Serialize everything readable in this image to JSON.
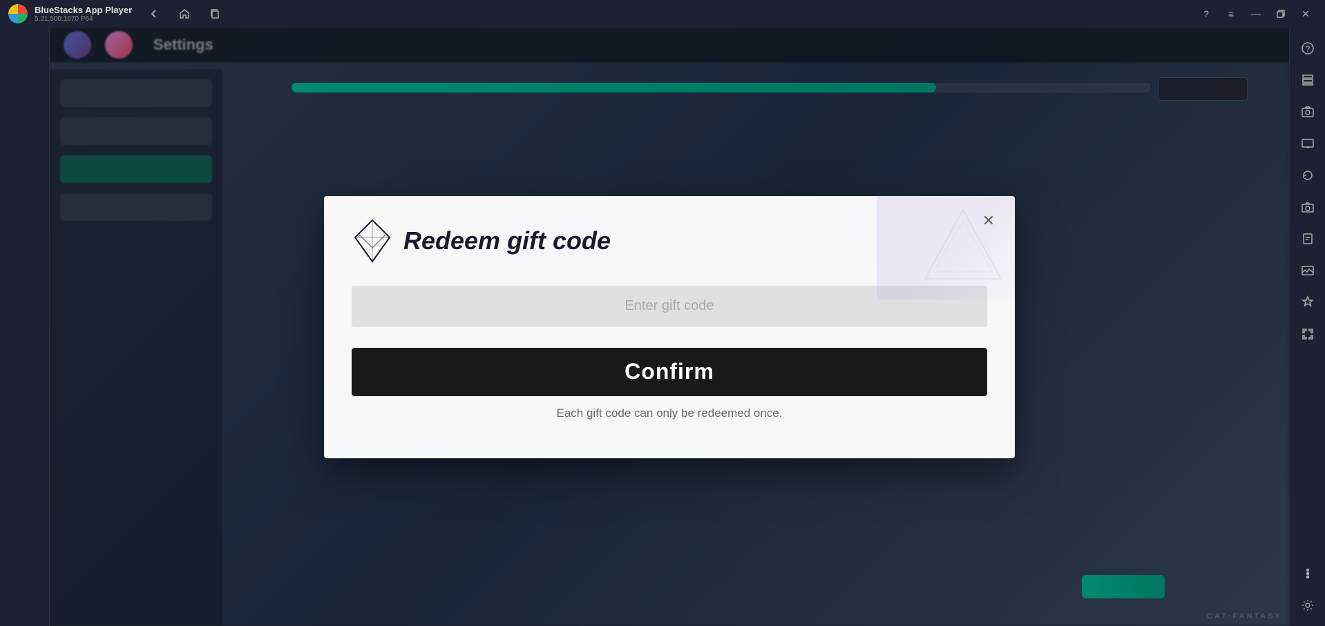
{
  "titleBar": {
    "appName": "BlueStacks App Player",
    "version": "5.21.500.1070  P64",
    "navBack": "←",
    "navHome": "⌂",
    "navCopy": "❐",
    "ctrlHelp": "?",
    "ctrlMenu": "≡",
    "ctrlMinimize": "—",
    "ctrlRestore": "❐",
    "ctrlClose": "✕"
  },
  "gameUI": {
    "settingsLabel": "Settings",
    "watermark": "CAT·FANTASY"
  },
  "modal": {
    "title": "Redeem gift code",
    "closeBtn": "✕",
    "inputPlaceholder": "Enter gift code",
    "confirmLabel": "Confirm",
    "noticeText": "Each gift code can only be redeemed once."
  },
  "rightSidebar": {
    "items": [
      {
        "name": "settings-icon",
        "label": "Settings"
      },
      {
        "name": "layout-icon",
        "label": "Layout"
      },
      {
        "name": "screenshot-icon",
        "label": "Screenshot"
      },
      {
        "name": "tv-icon",
        "label": "TV"
      },
      {
        "name": "rotate-icon",
        "label": "Rotate"
      },
      {
        "name": "camera-icon",
        "label": "Camera"
      },
      {
        "name": "resize-icon",
        "label": "Resize"
      },
      {
        "name": "photo-icon",
        "label": "Photo"
      },
      {
        "name": "magic-icon",
        "label": "Magic"
      },
      {
        "name": "undo-icon",
        "label": "Undo"
      },
      {
        "name": "more-icon",
        "label": "More"
      }
    ]
  }
}
